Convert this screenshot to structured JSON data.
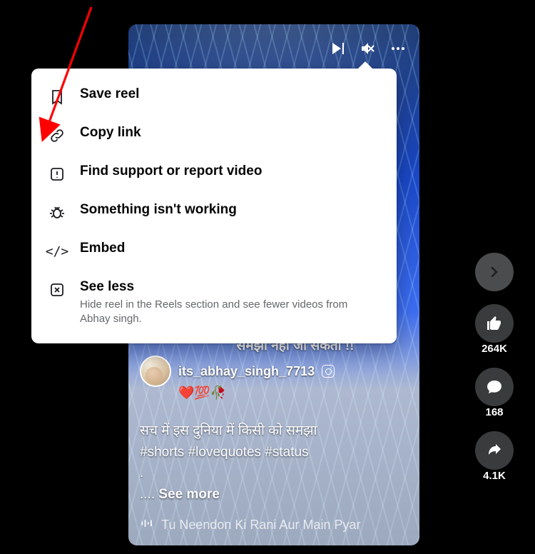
{
  "video": {
    "controls": {
      "play": "play-next",
      "mute": "muted"
    },
    "overlay": {
      "line1": "समझा नही जा सकता !!",
      "author": "its_abhay_singh_7713",
      "emoji": "❤️💯🥀",
      "caption_line1": "सच में इस दुनिया में किसी को समझा",
      "caption_line2": "#shorts #lovequotes #status",
      "caption_dot_line": ".",
      "see_more_prefix": ".... ",
      "see_more": "See more",
      "audio": "Tu Neendon Ki Rani Aur Main Pyar"
    }
  },
  "rail": {
    "like_count": "264K",
    "comment_count": "168",
    "share_count": "4.1K"
  },
  "menu": {
    "items": [
      {
        "label": "Save reel"
      },
      {
        "label": "Copy link"
      },
      {
        "label": "Find support or report video"
      },
      {
        "label": "Something isn't working"
      },
      {
        "label": "Embed"
      },
      {
        "label": "See less",
        "sub": "Hide reel in the Reels section and see fewer videos from Abhay singh."
      }
    ]
  }
}
